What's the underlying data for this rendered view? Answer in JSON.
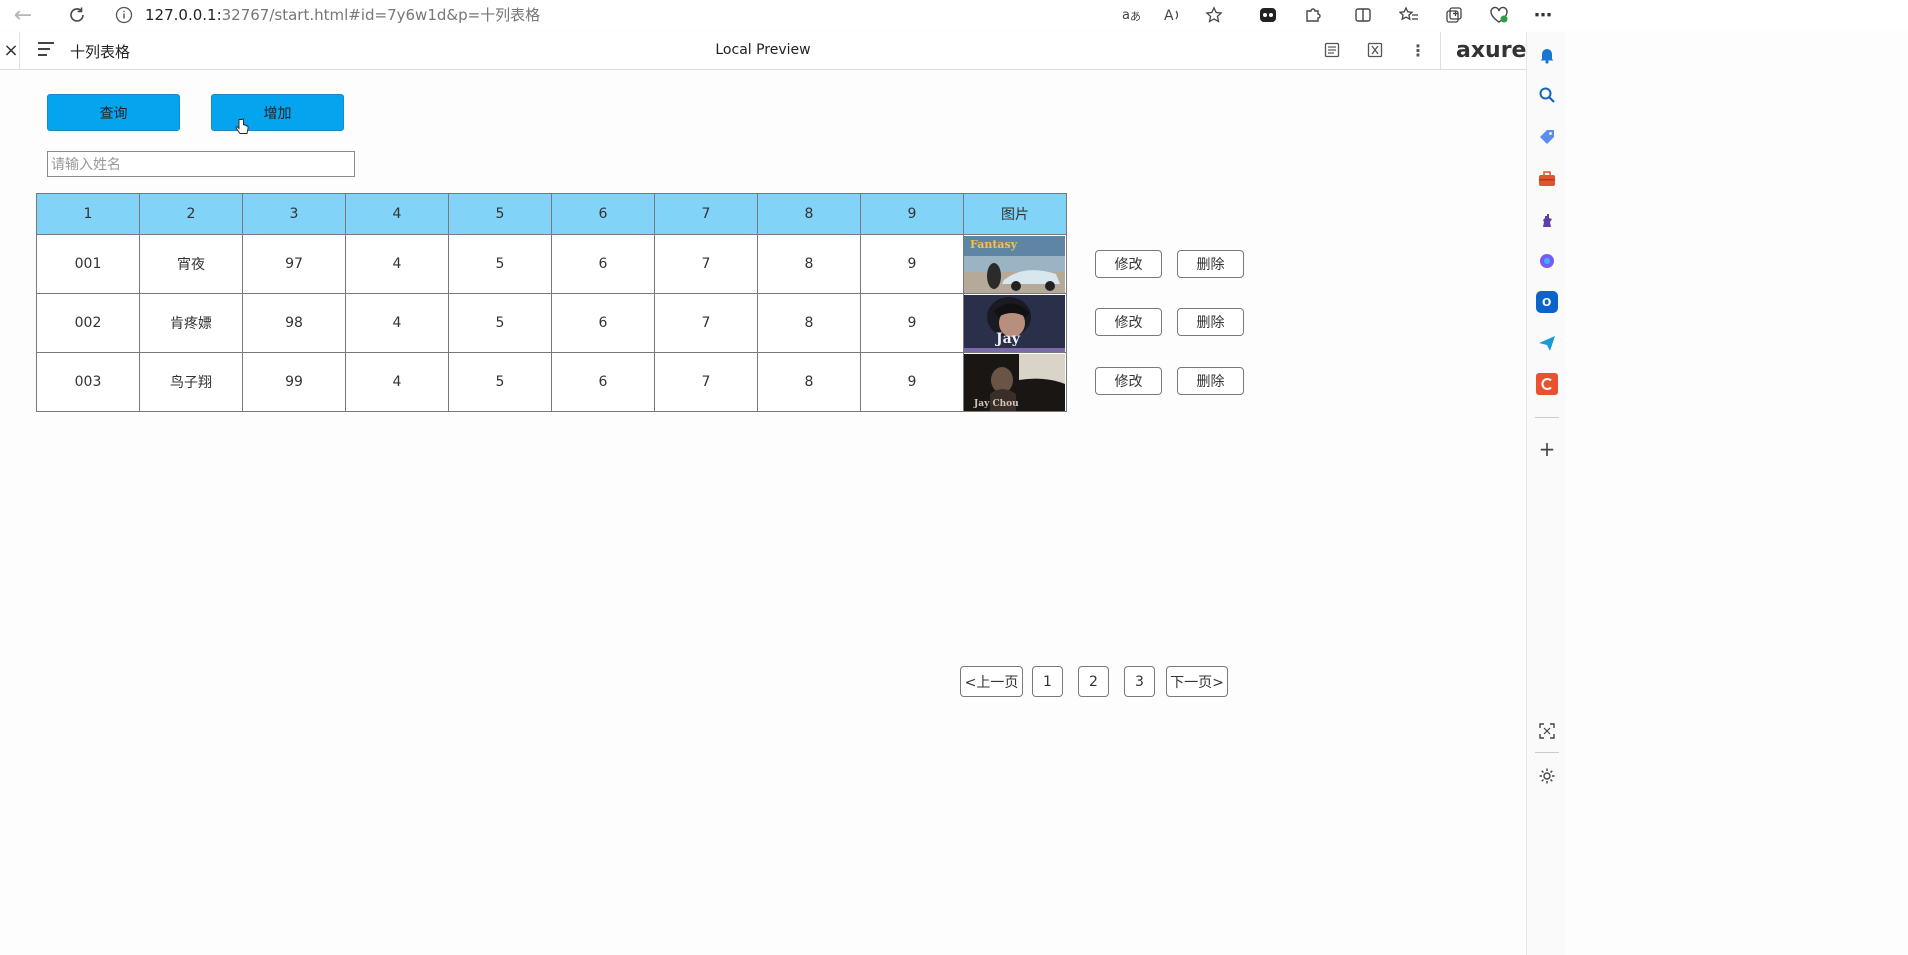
{
  "browser": {
    "url_main": "127.0.0.1:",
    "url_rest": "32767/start.html#id=7y6w1d&p=十列表格"
  },
  "axure": {
    "page_title": "十列表格",
    "center_label": "Local Preview",
    "logo": "axure",
    "close_glyph": "×"
  },
  "toolbar": {
    "query_label": "查询",
    "add_label": "增加",
    "search_placeholder": "请输入姓名"
  },
  "table": {
    "headers": [
      "1",
      "2",
      "3",
      "4",
      "5",
      "6",
      "7",
      "8",
      "9",
      "图片"
    ],
    "rows": [
      [
        "001",
        "宵夜",
        "97",
        "4",
        "5",
        "6",
        "7",
        "8",
        "9"
      ],
      [
        "002",
        "肯疼嫖",
        "98",
        "4",
        "5",
        "6",
        "7",
        "8",
        "9"
      ],
      [
        "003",
        "鸟子翔",
        "99",
        "4",
        "5",
        "6",
        "7",
        "8",
        "9"
      ]
    ],
    "image_texts": [
      "Fantasy",
      "Jay",
      "Jay Chou"
    ],
    "edit_label": "修改",
    "delete_label": "删除"
  },
  "pager": {
    "prev_label": "<上一页",
    "pages": [
      "1",
      "2",
      "3"
    ],
    "next_label": "下一页>"
  },
  "colors": {
    "primary_button": "#04a4ee",
    "header_bg": "#81d3f8"
  }
}
